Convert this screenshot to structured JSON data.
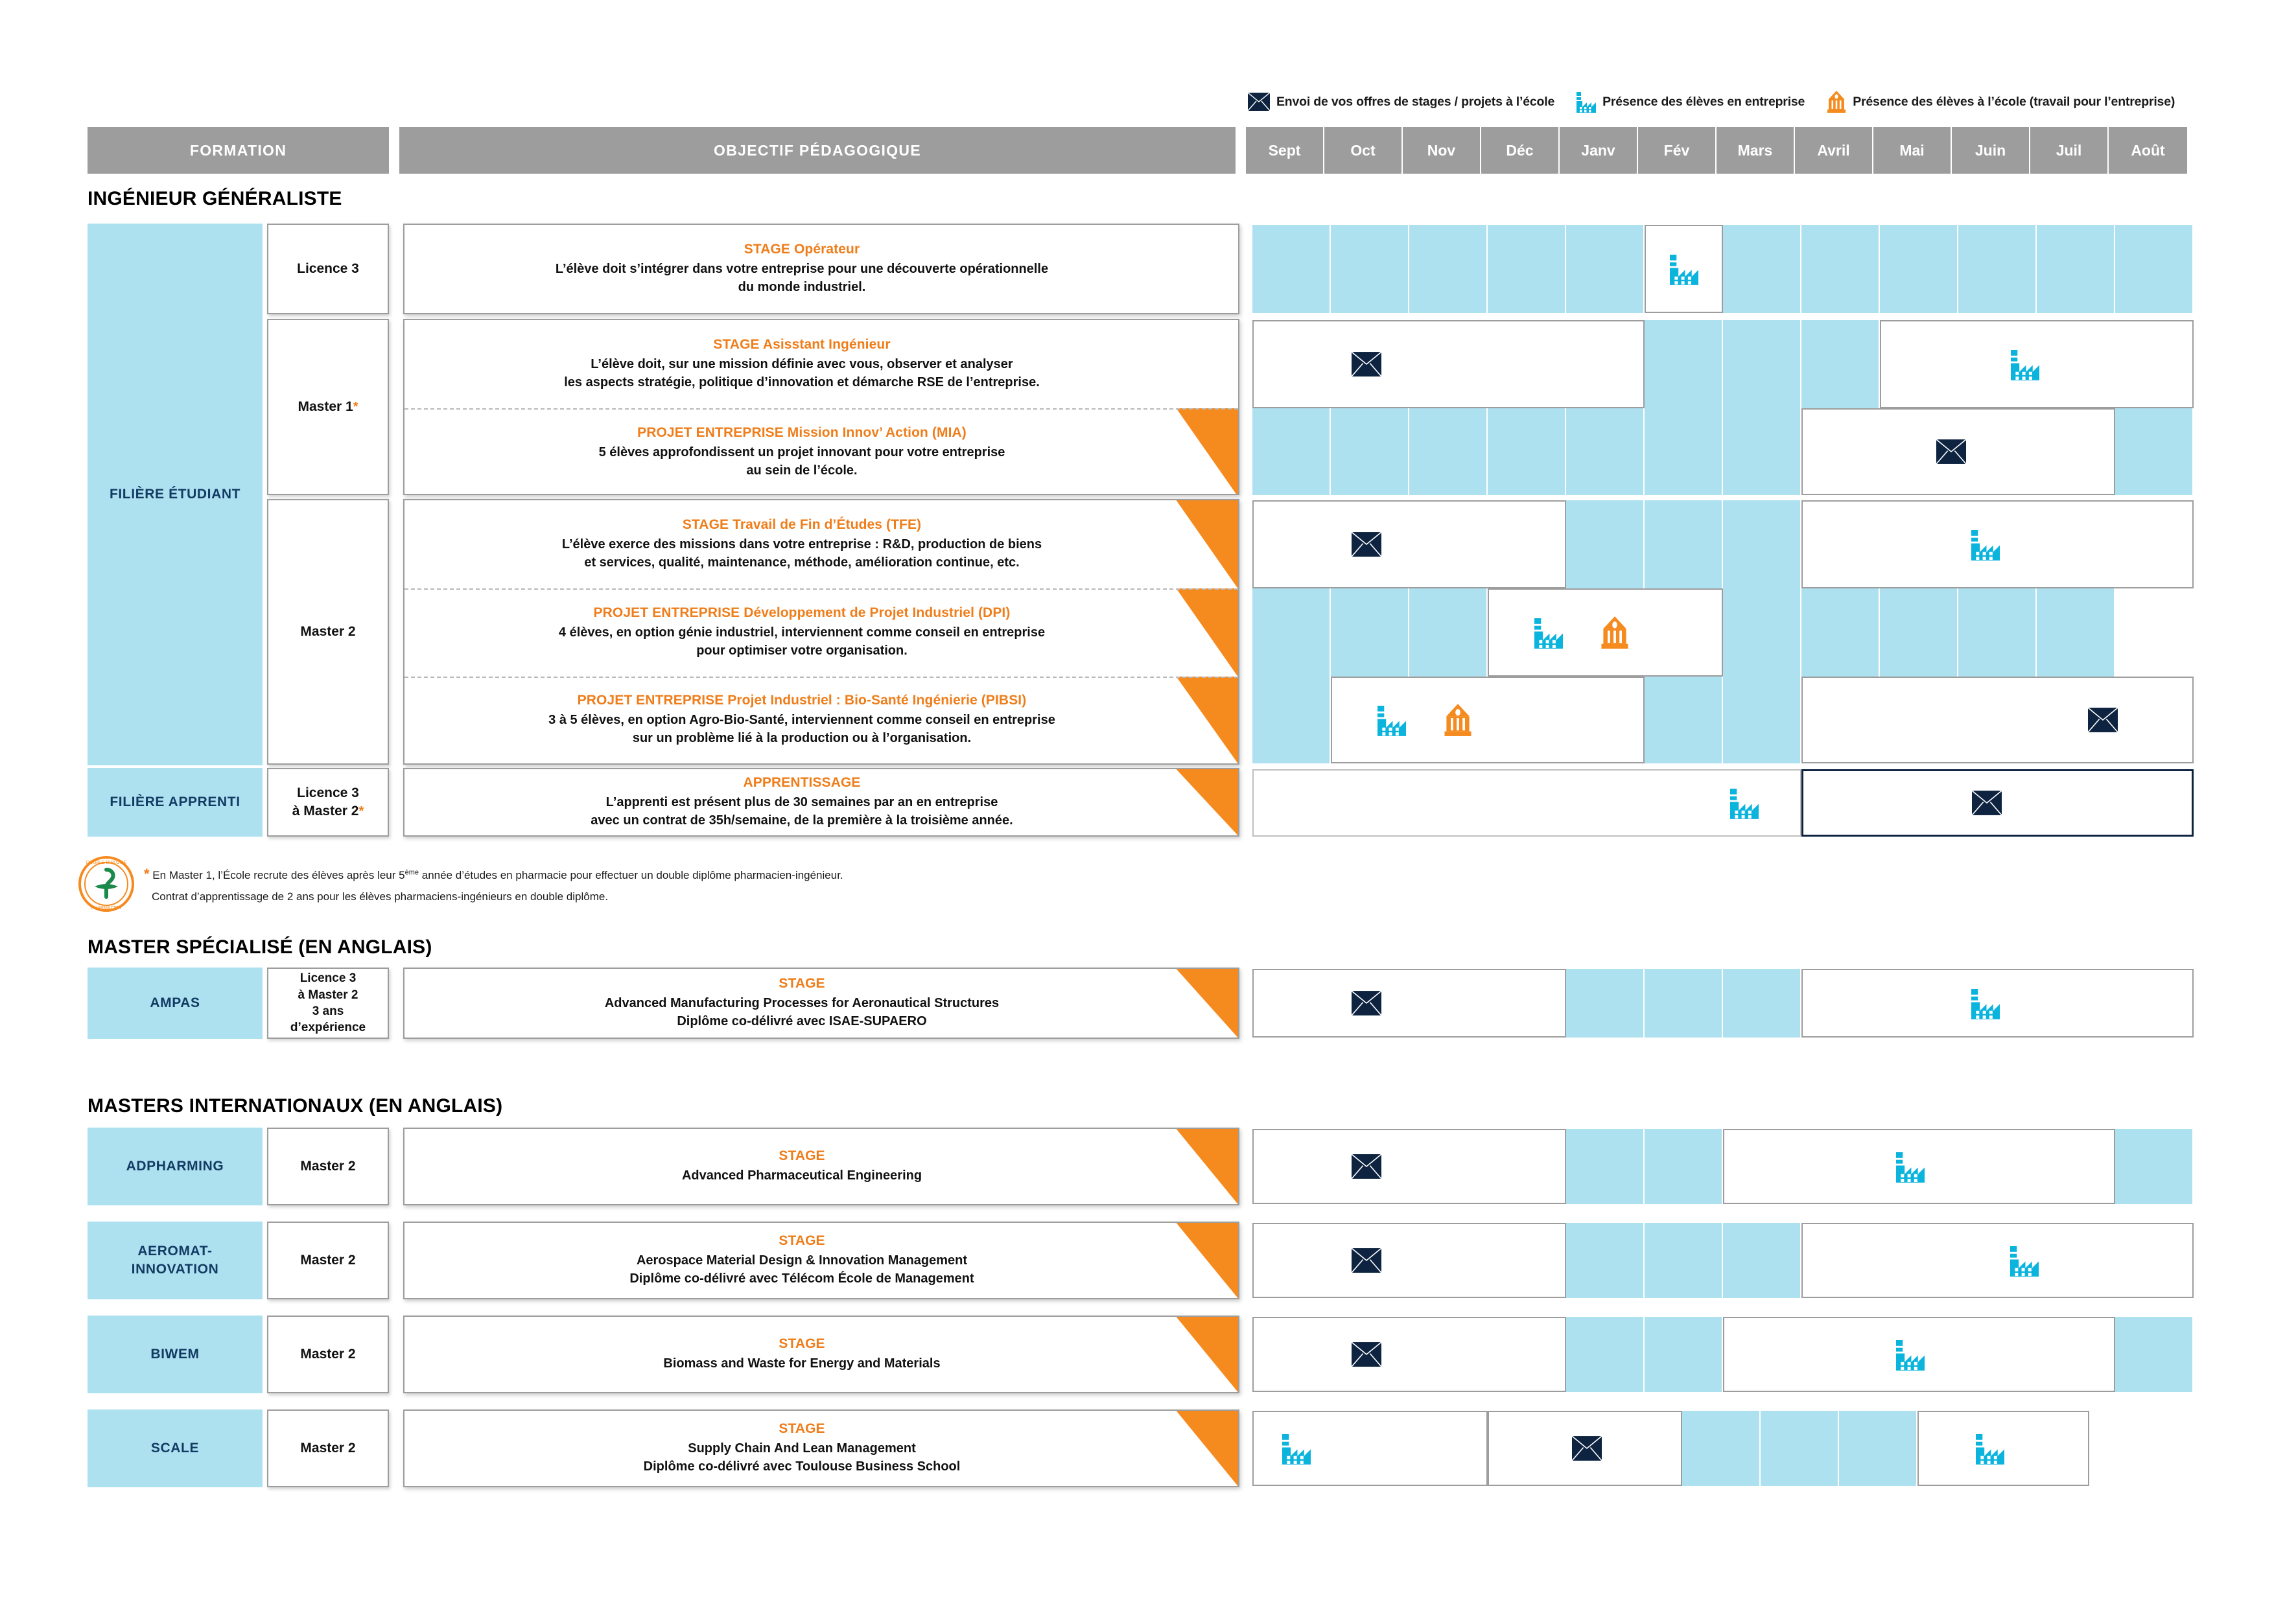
{
  "colors": {
    "accent_orange": "#f58a1f",
    "title_orange": "#ef7d1a",
    "light_blue": "#ade1f0",
    "icon_blue": "#0bb4dd",
    "header_grey": "#9d9d9d",
    "navy": "#0d2340"
  },
  "legend": [
    {
      "icon": "envelope-icon",
      "label": "Envoi de vos offres de stages / projets à l’école"
    },
    {
      "icon": "factory-icon",
      "label": "Présence des élèves en entreprise"
    },
    {
      "icon": "school-icon",
      "label": "Présence des élèves à l’école (travail pour l’entreprise)"
    }
  ],
  "header": {
    "formation": "FORMATION",
    "objectif": "OBJECTIF PÉDAGOGIQUE",
    "months": [
      "Sept",
      "Oct",
      "Nov",
      "Déc",
      "Janv",
      "Fév",
      "Mars",
      "Avril",
      "Mai",
      "Juin",
      "Juil",
      "Août"
    ]
  },
  "sections": {
    "ingenieur": "INGÉNIEUR GÉNÉRALISTE",
    "master_specialise": "MASTER SPÉCIALISÉ (EN ANGLAIS)",
    "masters_internationaux": "MASTERS INTERNATIONAUX (EN ANGLAIS)"
  },
  "filieres": {
    "etudiant": "FILIÈRE ÉTUDIANT",
    "apprenti": "FILIÈRE APPRENTI"
  },
  "niveaux": {
    "licence3": "Licence 3",
    "master1": "Master 1",
    "master1_star": "*",
    "master2": "Master 2",
    "l3_a_m2_l1": "Licence 3",
    "l3_a_m2_l2": "à Master 2",
    "l3_a_m2_star": "*",
    "ampas_l1": "Licence 3",
    "ampas_l2": "à Master 2",
    "ampas_l3": "3 ans",
    "ampas_l4": "d’expérience"
  },
  "rows": {
    "stage_operateur": {
      "title": "STAGE Opérateur",
      "body_l1": "L’élève doit s’intégrer dans votre entreprise pour une découverte opérationnelle",
      "body_l2": "du monde industriel."
    },
    "stage_assistant": {
      "title": "STAGE Asisstant Ingénieur",
      "body_l1": "L’élève doit, sur une mission définie avec vous, observer et analyser",
      "body_l2": "les aspects stratégie, politique d’innovation et démarche RSE de l’entreprise."
    },
    "mia": {
      "title": "PROJET ENTREPRISE Mission Innov’ Action (MIA)",
      "body_l1": "5 élèves approfondissent un projet innovant pour votre entreprise",
      "body_l2": "au sein de l’école."
    },
    "tfe": {
      "title": "STAGE Travail de Fin d’Études (TFE)",
      "body_l1": "L’élève exerce des missions dans votre entreprise : R&D, production de biens",
      "body_l2": "et services, qualité, maintenance, méthode, amélioration continue, etc."
    },
    "dpi": {
      "title": "PROJET ENTREPRISE Développement de Projet Industriel (DPI)",
      "body_l1": "4 élèves, en option génie industriel, interviennent comme conseil en entreprise",
      "body_l2": "pour optimiser votre organisation."
    },
    "pibsi": {
      "title": "PROJET ENTREPRISE Projet Industriel : Bio-Santé Ingénierie (PIBSI)",
      "body_l1": "3 à 5 élèves, en option Agro-Bio-Santé, interviennent comme conseil en entreprise",
      "body_l2": "sur un problème lié à la production ou à l’organisation."
    },
    "apprentissage": {
      "title": "APPRENTISSAGE",
      "body_l1": "L’apprenti est présent plus de 30 semaines par an en entreprise",
      "body_l2": "avec un contrat de 35h/semaine, de la première à la troisième année."
    },
    "ampas": {
      "name": "AMPAS",
      "title": "STAGE",
      "body_l1": "Advanced Manufacturing Processes for Aeronautical Structures",
      "body_l2": "Diplôme co-délivré avec ISAE-SUPAERO"
    },
    "adpharming": {
      "name": "ADPHARMING",
      "niveau": "Master 2",
      "title": "STAGE",
      "body_l1": "Advanced Pharmaceutical Engineering",
      "body_l2": ""
    },
    "aeromat": {
      "name_l1": "AEROMAT-",
      "name_l2": "INNOVATION",
      "niveau": "Master 2",
      "title": "STAGE",
      "body_l1": "Aerospace Material Design & Innovation Management",
      "body_l2": "Diplôme co-délivré avec Télécom École de Management"
    },
    "biwem": {
      "name": "BIWEM",
      "niveau": "Master 2",
      "title": "STAGE",
      "body_l1": "Biomass and Waste for Energy and Materials",
      "body_l2": ""
    },
    "scale": {
      "name": "SCALE",
      "niveau": "Master 2",
      "title": "STAGE",
      "body_l1": "Supply Chain And Lean Management",
      "body_l2": "Diplôme co-délivré avec Toulouse Business School"
    }
  },
  "footnote": {
    "star": "*",
    "line1_a": "En Master 1, l’École recrute des élèves après leur 5",
    "line1_sup": "ème",
    "line1_b": " année d’études en pharmacie pour effectuer un double diplôme pharmacien-ingénieur.",
    "line2": "Contrat d’apprentissage de 2 ans pour les élèves pharmaciens-ingénieurs en double diplôme."
  },
  "timelines": {
    "stage_operateur": [
      "blue",
      "blue",
      "blue",
      "blue",
      "blue",
      "white-factory",
      "blue",
      "blue",
      "blue",
      "blue",
      "blue",
      "blue"
    ],
    "stage_assistant": [
      "white",
      "white-envelope",
      "white",
      "white",
      "white",
      "blue",
      "blue",
      "blue",
      "white",
      "white-factory",
      "white",
      "white"
    ],
    "mia": [
      "blue",
      "blue",
      "blue",
      "blue",
      "blue",
      "blue",
      "blue",
      "white",
      "white-envelope",
      "white",
      "white",
      "blue"
    ],
    "tfe": [
      "white",
      "white-envelope",
      "white",
      "white",
      "blue",
      "blue",
      "blue",
      "white",
      "white",
      "white-factory",
      "white",
      "white"
    ],
    "dpi": [
      "blue",
      "blue",
      "blue",
      "white",
      "white-factory",
      "white-school",
      "white",
      "blue",
      "blue",
      "blue",
      "blue",
      "blue"
    ],
    "pibsi": [
      "blue",
      "white",
      "white-factory",
      "white-school",
      "white",
      "blue",
      "blue",
      "white",
      "white",
      "white",
      "white-envelope",
      "white"
    ],
    "apprentissage": [
      "white",
      "white",
      "white",
      "white",
      "white",
      "white",
      "white-factory",
      "dark-envelope",
      "dark",
      "dark",
      "dark",
      "dark"
    ],
    "ampas": [
      "white",
      "white-envelope",
      "white",
      "white",
      "blue",
      "blue",
      "blue",
      "white",
      "white",
      "white-factory",
      "white",
      "white"
    ],
    "adpharming": [
      "white",
      "white-envelope",
      "white",
      "white",
      "blue",
      "blue",
      "white",
      "white",
      "white-factory",
      "white",
      "white",
      "blue"
    ],
    "aeromat": [
      "white",
      "white-envelope",
      "white",
      "white",
      "blue",
      "blue",
      "blue",
      "white",
      "white",
      "white-factory",
      "white",
      "white"
    ],
    "biwem": [
      "white",
      "white-envelope",
      "white",
      "white",
      "blue",
      "blue",
      "white",
      "white",
      "white-factory",
      "white",
      "white",
      "blue"
    ],
    "scale": [
      "white-factory",
      "white",
      "white",
      "white",
      "white",
      "white-envelope",
      "white",
      "blue",
      "blue",
      "blue",
      "white-factory",
      "white"
    ]
  }
}
